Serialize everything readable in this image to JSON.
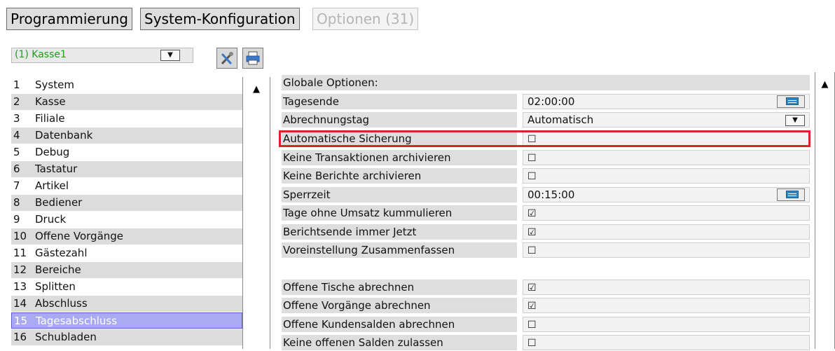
{
  "tabs": [
    {
      "label": "Programmierung"
    },
    {
      "label": "System-Konfiguration"
    },
    {
      "label": "Optionen (31)"
    }
  ],
  "register_select": {
    "value": "(1) Kasse1",
    "arrow": "▼",
    "value_color": "#1aa11a"
  },
  "toolbar": {
    "tools_icon": "tools-icon",
    "print_icon": "printer-icon"
  },
  "sidebar": {
    "items": [
      {
        "num": "1",
        "label": "System"
      },
      {
        "num": "2",
        "label": "Kasse"
      },
      {
        "num": "3",
        "label": "Filiale"
      },
      {
        "num": "4",
        "label": "Datenbank"
      },
      {
        "num": "5",
        "label": "Debug"
      },
      {
        "num": "6",
        "label": "Tastatur"
      },
      {
        "num": "7",
        "label": "Artikel"
      },
      {
        "num": "8",
        "label": "Bediener"
      },
      {
        "num": "9",
        "label": "Druck"
      },
      {
        "num": "10",
        "label": "Offene Vorgänge"
      },
      {
        "num": "11",
        "label": "Gästezahl"
      },
      {
        "num": "12",
        "label": "Bereiche"
      },
      {
        "num": "13",
        "label": "Splitten"
      },
      {
        "num": "14",
        "label": "Abschluss"
      },
      {
        "num": "15",
        "label": "Tagesabschluss"
      },
      {
        "num": "16",
        "label": "Schubladen"
      }
    ],
    "selected_num": "15",
    "selected_color": "#aaaaf2"
  },
  "options": {
    "header": "Globale Optionen:",
    "rows": [
      {
        "label": "Tagesende",
        "value": "02:00:00"
      },
      {
        "label": "Abrechnungstag",
        "value": "Automatisch"
      },
      {
        "label": "Automatische Sicherung",
        "value": "☐"
      },
      {
        "label": "Keine Transaktionen archivieren",
        "value": "☐"
      },
      {
        "label": "Keine Berichte archivieren",
        "value": "☐"
      },
      {
        "label": "Sperrzeit",
        "value": "00:15:00"
      },
      {
        "label": "Tage ohne Umsatz kummulieren",
        "value": "☑"
      },
      {
        "label": "Berichtsende immer Jetzt",
        "value": "☑"
      },
      {
        "label": "Voreinstellung Zusammenfassen",
        "value": "☐"
      },
      {
        "label": "Offene Tische abrechnen",
        "value": "☑"
      },
      {
        "label": "Offene Vorgänge abrechnen",
        "value": "☑"
      },
      {
        "label": "Offene Kundensalden abrechnen",
        "value": "☐"
      },
      {
        "label": "Keine offenen Salden zulassen",
        "value": "☐"
      }
    ],
    "highlight_color": "#e0202a"
  },
  "scroll_up_arrow": "▲",
  "dropdown_arrow": "▼"
}
